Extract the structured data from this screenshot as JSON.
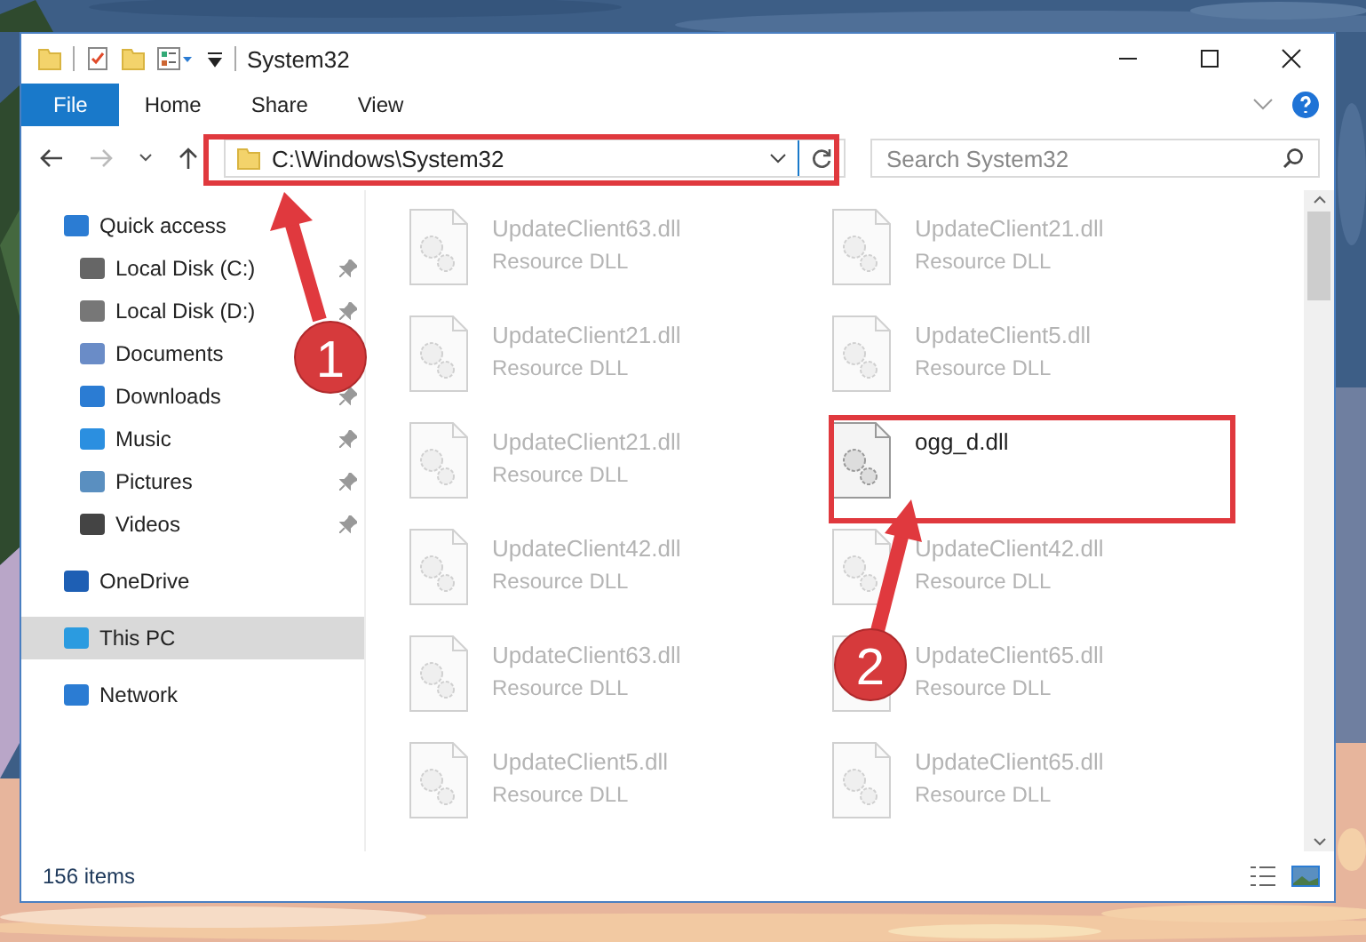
{
  "window": {
    "title": "System32"
  },
  "ribbon_tabs": [
    {
      "label": "File",
      "selected": true
    },
    {
      "label": "Home",
      "selected": false
    },
    {
      "label": "Share",
      "selected": false
    },
    {
      "label": "View",
      "selected": false
    }
  ],
  "address_bar": {
    "path": "C:\\Windows\\System32"
  },
  "search": {
    "placeholder": "Search System32"
  },
  "navigation": [
    {
      "label": "Quick access",
      "selected": false,
      "children": [
        {
          "label": "Local Disk (C:)",
          "pinned": true,
          "selected": false
        },
        {
          "label": "Local Disk (D:)",
          "pinned": true,
          "selected": false
        },
        {
          "label": "Documents",
          "selected": false
        },
        {
          "label": "Downloads",
          "pinned": true,
          "selected": false
        },
        {
          "label": "Music",
          "pinned": true,
          "selected": false
        },
        {
          "label": "Pictures",
          "pinned": true,
          "selected": false
        },
        {
          "label": "Videos",
          "pinned": true,
          "selected": false
        }
      ]
    },
    {
      "label": "OneDrive",
      "selected": false
    },
    {
      "label": "This PC",
      "selected": true
    },
    {
      "label": "Network",
      "selected": false
    }
  ],
  "files": [
    {
      "name": "UpdateClient63.dll",
      "type": "Resource DLL",
      "blurred": true
    },
    {
      "name": "UpdateClient21.dll",
      "type": "Resource DLL",
      "blurred": true
    },
    {
      "name": "UpdateClient21.dll",
      "type": "Resource DLL",
      "blurred": true
    },
    {
      "name": "UpdateClient5.dll",
      "type": "Resource DLL",
      "blurred": true
    },
    {
      "name": "UpdateClient21.dll",
      "type": "Resource DLL",
      "blurred": true
    },
    {
      "name": "ogg_d.dll",
      "blurred": false
    },
    {
      "name": "UpdateClient42.dll",
      "type": "Resource DLL",
      "blurred": true
    },
    {
      "name": "UpdateClient42.dll",
      "type": "Resource DLL",
      "blurred": true
    },
    {
      "name": "UpdateClient63.dll",
      "type": "Resource DLL",
      "blurred": true
    },
    {
      "name": "UpdateClient65.dll",
      "type": "Resource DLL",
      "blurred": true
    },
    {
      "name": "UpdateClient5.dll",
      "type": "Resource DLL",
      "blurred": true
    },
    {
      "name": "UpdateClient65.dll",
      "type": "Resource DLL",
      "blurred": true
    }
  ],
  "status_bar": {
    "item_count": "156 items"
  },
  "annotations": [
    {
      "label": "1"
    },
    {
      "label": "2"
    }
  ]
}
